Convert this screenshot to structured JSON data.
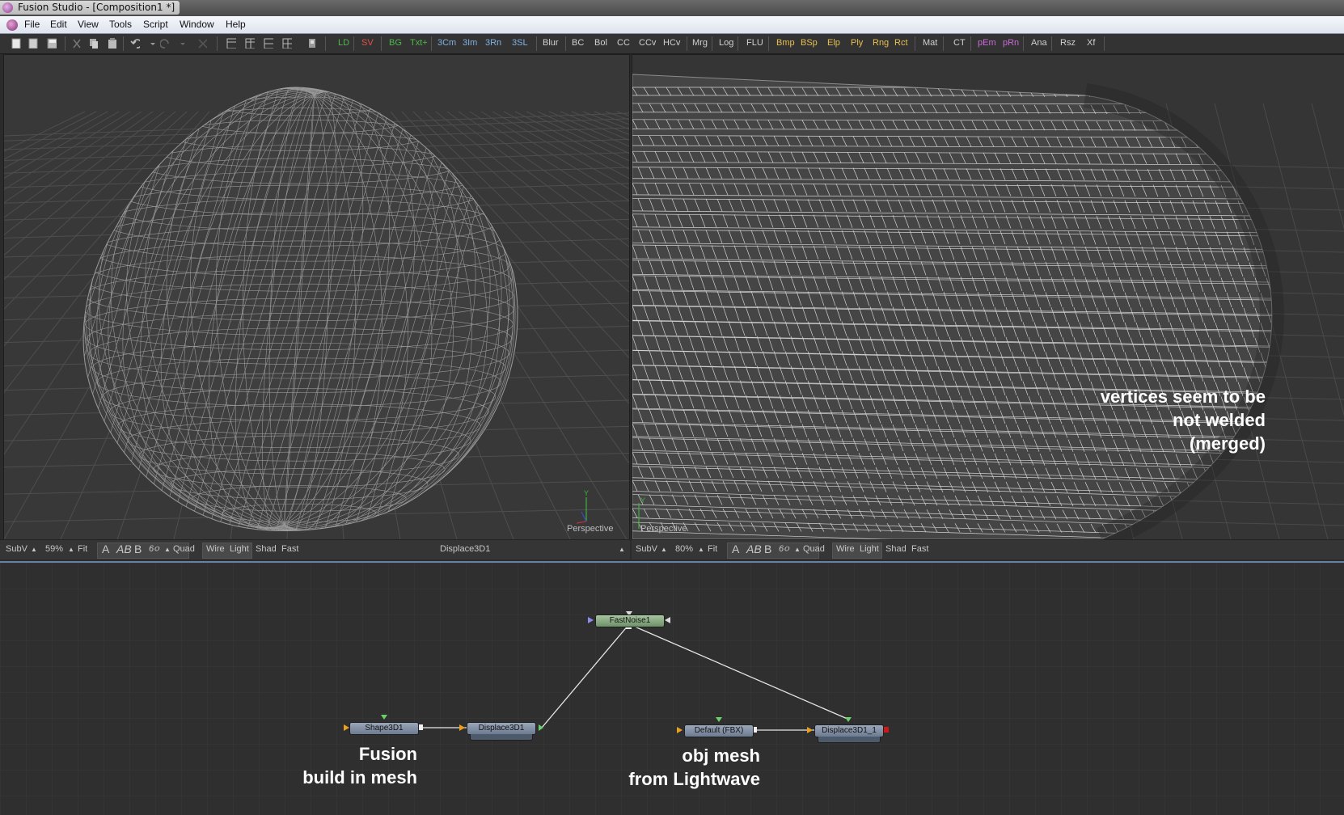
{
  "window": {
    "title": "Fusion Studio - [Composition1 *]"
  },
  "menu": {
    "items": [
      "File",
      "Edit",
      "View",
      "Tools",
      "Script",
      "Window",
      "Help"
    ]
  },
  "toolbar": {
    "tools": [
      {
        "label": "LD",
        "color": "#4db84d"
      },
      {
        "label": "SV",
        "color": "#e0504a"
      },
      {
        "label": "BG",
        "color": "#4db84d"
      },
      {
        "label": "Txt+",
        "color": "#4db84d"
      },
      {
        "label": "3Cm",
        "color": "#7fb2e0"
      },
      {
        "label": "3Im",
        "color": "#7fb2e0"
      },
      {
        "label": "3Rn",
        "color": "#7fb2e0"
      },
      {
        "label": "3SL",
        "color": "#7fb2e0"
      },
      {
        "label": "Blur",
        "color": "#d0d0d0"
      },
      {
        "label": "BC",
        "color": "#d0d0d0"
      },
      {
        "label": "Bol",
        "color": "#d0d0d0"
      },
      {
        "label": "CC",
        "color": "#d0d0d0"
      },
      {
        "label": "CCv",
        "color": "#d0d0d0"
      },
      {
        "label": "HCv",
        "color": "#d0d0d0"
      },
      {
        "label": "Mrg",
        "color": "#d0d0d0"
      },
      {
        "label": "Log",
        "color": "#d0d0d0"
      },
      {
        "label": "FLU",
        "color": "#d0d0d0"
      },
      {
        "label": "Bmp",
        "color": "#e6c050"
      },
      {
        "label": "BSp",
        "color": "#e6c050"
      },
      {
        "label": "Elp",
        "color": "#e6c050"
      },
      {
        "label": "Ply",
        "color": "#e6c050"
      },
      {
        "label": "Rng",
        "color": "#e6c050"
      },
      {
        "label": "Rct",
        "color": "#e6c050"
      },
      {
        "label": "Mat",
        "color": "#d0d0d0"
      },
      {
        "label": "CT",
        "color": "#d0d0d0"
      },
      {
        "label": "pEm",
        "color": "#c86ad8"
      },
      {
        "label": "pRn",
        "color": "#c86ad8"
      },
      {
        "label": "Ana",
        "color": "#d0d0d0"
      },
      {
        "label": "Rsz",
        "color": "#d0d0d0"
      },
      {
        "label": "Xf",
        "color": "#d0d0d0"
      }
    ]
  },
  "viewer_left": {
    "camera_label": "Perspective",
    "axis": "Y",
    "bar": {
      "subv": "SubV",
      "zoom": "59%",
      "fit": "Fit",
      "a": "A",
      "ab": "AB",
      "b": "B",
      "quad": "Quad",
      "wire": "Wire",
      "light": "Light",
      "shad": "Shad",
      "fast": "Fast",
      "node": "Displace3D1"
    }
  },
  "viewer_right": {
    "camera_label": "Perspective",
    "axis": "Y",
    "annotation": [
      "vertices seem to be",
      "not welded",
      "(merged)"
    ],
    "bar": {
      "subv": "SubV",
      "zoom": "80%",
      "fit": "Fit",
      "a": "A",
      "ab": "AB",
      "b": "B",
      "quad": "Quad",
      "wire": "Wire",
      "light": "Light",
      "shad": "Shad",
      "fast": "Fast"
    }
  },
  "flow": {
    "nodes": {
      "noise": "FastNoise1",
      "shape": "Shape3D1",
      "displace1": "Displace3D1",
      "fbx": "Default (FBX)",
      "displace2": "Displace3D1_1"
    },
    "label_left": [
      "Fusion",
      "build in mesh"
    ],
    "label_right": [
      "obj mesh",
      "from Lightwave"
    ]
  }
}
